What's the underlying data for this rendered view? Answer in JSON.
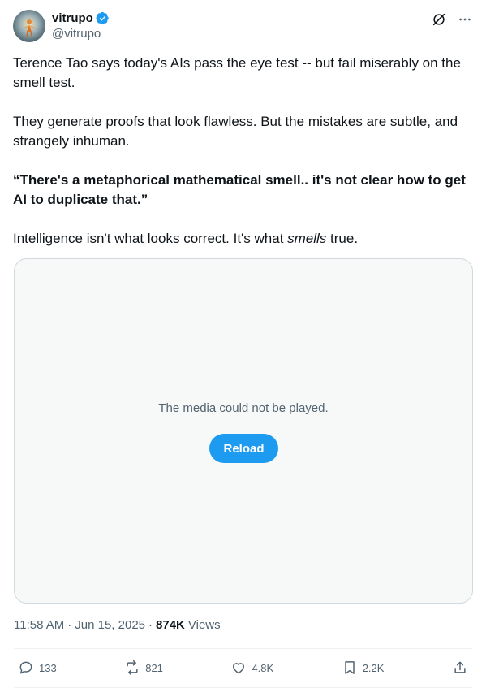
{
  "author": {
    "display_name": "vitrupo",
    "handle": "@vitrupo",
    "verified": true,
    "accent_color": "#1d9bf0"
  },
  "header_icons": [
    "grok-icon",
    "more-icon"
  ],
  "tweet": {
    "paragraphs": [
      "Terence Tao says today's AIs pass the eye test -- but fail miserably on the smell test.",
      "They generate proofs that look flawless. But the mistakes are subtle, and strangely inhuman.",
      "“There's a metaphorical mathematical smell.. it's not clear how to get AI to duplicate that.”"
    ],
    "last_paragraph": {
      "before": "Intelligence isn't what looks correct. It's what ",
      "emphasis": "smells",
      "after": " true."
    }
  },
  "media": {
    "message": "The media could not be played.",
    "reload_label": "Reload"
  },
  "meta": {
    "time": "11:58 AM",
    "date": "Jun 15, 2025",
    "separator": "·",
    "views_count": "874K",
    "views_label": "Views"
  },
  "actions": {
    "replies": "133",
    "reposts": "821",
    "likes": "4.8K",
    "bookmarks": "2.2K"
  },
  "colors": {
    "text_primary": "#0f1419",
    "text_secondary": "#536471",
    "border": "#cfd9de",
    "media_bg": "#f7f9f9",
    "button": "#1d9bf0"
  }
}
